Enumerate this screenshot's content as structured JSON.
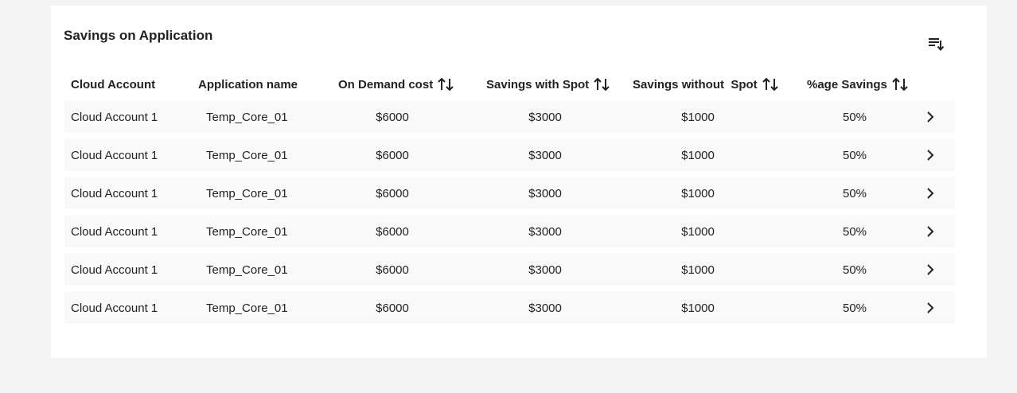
{
  "card": {
    "title": "Savings on Application",
    "sort_list_icon": "sort-list-icon"
  },
  "table": {
    "headers": [
      {
        "label": "Cloud Account",
        "sortable": false
      },
      {
        "label": "Application name",
        "sortable": false
      },
      {
        "label": "On Demand cost",
        "sortable": true
      },
      {
        "label": "Savings with Spot",
        "sortable": true
      },
      {
        "label": "Savings without  Spot",
        "sortable": true
      },
      {
        "label": "%age Savings",
        "sortable": true
      }
    ],
    "rows": [
      {
        "account": "Cloud Account 1",
        "app": "Temp_Core_01",
        "on_demand": "$6000",
        "with_spot": "$3000",
        "without_spot": "$1000",
        "pct": "50%"
      },
      {
        "account": "Cloud Account 1",
        "app": "Temp_Core_01",
        "on_demand": "$6000",
        "with_spot": "$3000",
        "without_spot": "$1000",
        "pct": "50%"
      },
      {
        "account": "Cloud Account 1",
        "app": "Temp_Core_01",
        "on_demand": "$6000",
        "with_spot": "$3000",
        "without_spot": "$1000",
        "pct": "50%"
      },
      {
        "account": "Cloud Account 1",
        "app": "Temp_Core_01",
        "on_demand": "$6000",
        "with_spot": "$3000",
        "without_spot": "$1000",
        "pct": "50%"
      },
      {
        "account": "Cloud Account 1",
        "app": "Temp_Core_01",
        "on_demand": "$6000",
        "with_spot": "$3000",
        "without_spot": "$1000",
        "pct": "50%"
      },
      {
        "account": "Cloud Account 1",
        "app": "Temp_Core_01",
        "on_demand": "$6000",
        "with_spot": "$3000",
        "without_spot": "$1000",
        "pct": "50%"
      }
    ],
    "row_icon": "chevron-right-icon",
    "sort_icon": "sort-arrows-icon"
  }
}
